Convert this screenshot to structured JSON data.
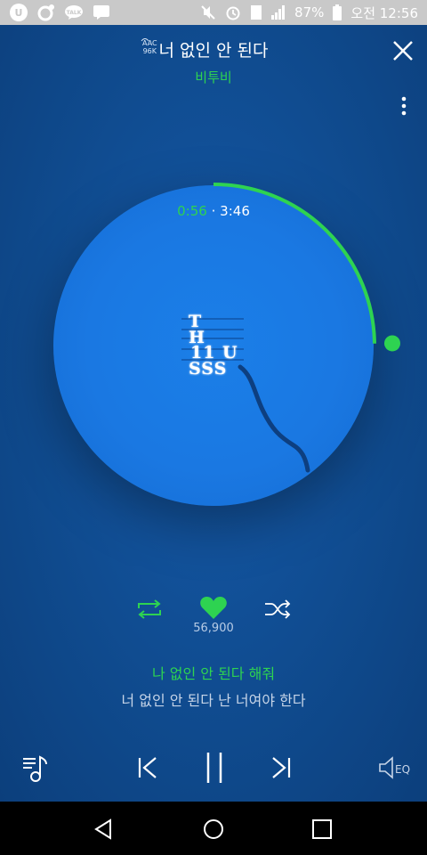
{
  "status_bar": {
    "battery": "87%",
    "time": "오전 12:56",
    "left_icons": [
      "u-plus-icon",
      "chat-bubble-icon",
      "kakaotalk-icon",
      "message-icon"
    ],
    "right_icons": [
      "mute-icon",
      "alarm-icon",
      "lte-icon",
      "signal-icon",
      "battery-icon"
    ]
  },
  "header": {
    "title": "너 없인 안 된다",
    "quality_line1": "AAC",
    "quality_line2": "96K",
    "artist": "비투비"
  },
  "player": {
    "current_time": "0:56",
    "separator": "·",
    "total_time": "3:46",
    "progress_fraction": 0.248
  },
  "album_art": {
    "line1": "T",
    "line2": "H",
    "line3": "11",
    "line4a": "SSS",
    "line4b": "U"
  },
  "actions": {
    "like_count": "56,900"
  },
  "lyrics": {
    "current": "나 없인 안 된다 해줘",
    "next": "너 없인 안 된다 난 너여야 한다"
  },
  "bottom_controls": {
    "eq_label": "EQ"
  },
  "colors": {
    "accent": "#2ed351",
    "background": "#0f4a8d",
    "disc": "#1a78e2"
  }
}
